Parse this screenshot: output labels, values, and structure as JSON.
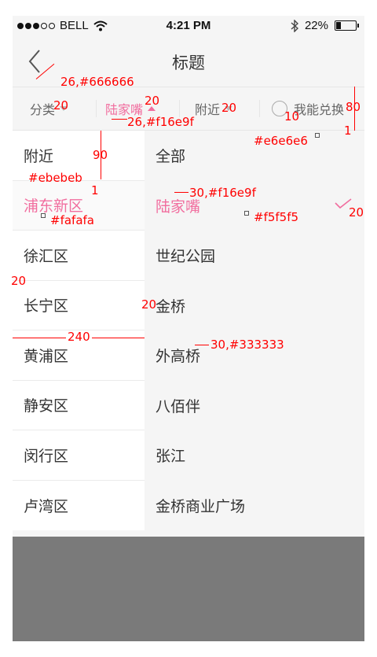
{
  "status_bar": {
    "carrier": "BELL",
    "time": "4:21 PM",
    "battery": "22%",
    "battery_level": 0.22
  },
  "nav": {
    "title": "标题",
    "back_icon": "chevron-left-icon"
  },
  "filter_bar": {
    "tabs": [
      {
        "label": "分类",
        "active": false
      },
      {
        "label": "陆家嘴",
        "active": true
      },
      {
        "label": "附近",
        "active": false
      }
    ],
    "search_placeholder": "我能兑换"
  },
  "left_list": [
    {
      "label": "附近",
      "selected": false
    },
    {
      "label": "浦东新区",
      "selected": true
    },
    {
      "label": "徐汇区",
      "selected": false
    },
    {
      "label": "长宁区",
      "selected": false
    },
    {
      "label": "黄浦区",
      "selected": false
    },
    {
      "label": "静安区",
      "selected": false
    },
    {
      "label": "闵行区",
      "selected": false
    },
    {
      "label": "卢湾区",
      "selected": false
    }
  ],
  "right_list": [
    {
      "label": "全部",
      "selected": false
    },
    {
      "label": "陆家嘴",
      "selected": true
    },
    {
      "label": "世纪公园",
      "selected": false
    },
    {
      "label": "金桥",
      "selected": false
    },
    {
      "label": "外高桥",
      "selected": false
    },
    {
      "label": "八佰伴",
      "selected": false
    },
    {
      "label": "张江",
      "selected": false
    },
    {
      "label": "金桥商业广场",
      "selected": false
    }
  ],
  "colors": {
    "accent": "#f16e9f",
    "text": "#333333",
    "tab_text": "#666666",
    "divider": "#e6e6e6",
    "left_divider": "#ebebeb",
    "left_selected_bg": "#fafafa",
    "right_bg": "#f5f5f5",
    "annotation": "#ff0000"
  },
  "annotations": {
    "tab_font": "26,#666666",
    "tab_active_font": "26,#f16e9f",
    "divider_color": "#e6e6e6",
    "filter_height": "80",
    "divider_width": "1",
    "gap_caret": "20",
    "gap_active": "20",
    "gap_nearby": "20",
    "gap_search": "10",
    "row_height": "90",
    "left_divider_color": "#ebebeb",
    "left_divider_width": "1",
    "selected_font": "30,#f16e9f",
    "left_selected_bg": "#fafafa",
    "right_bg": "#f5f5f5",
    "check_margin": "20",
    "left_padding": "20",
    "right_padding": "20",
    "left_width": "240",
    "item_font": "30,#333333"
  }
}
